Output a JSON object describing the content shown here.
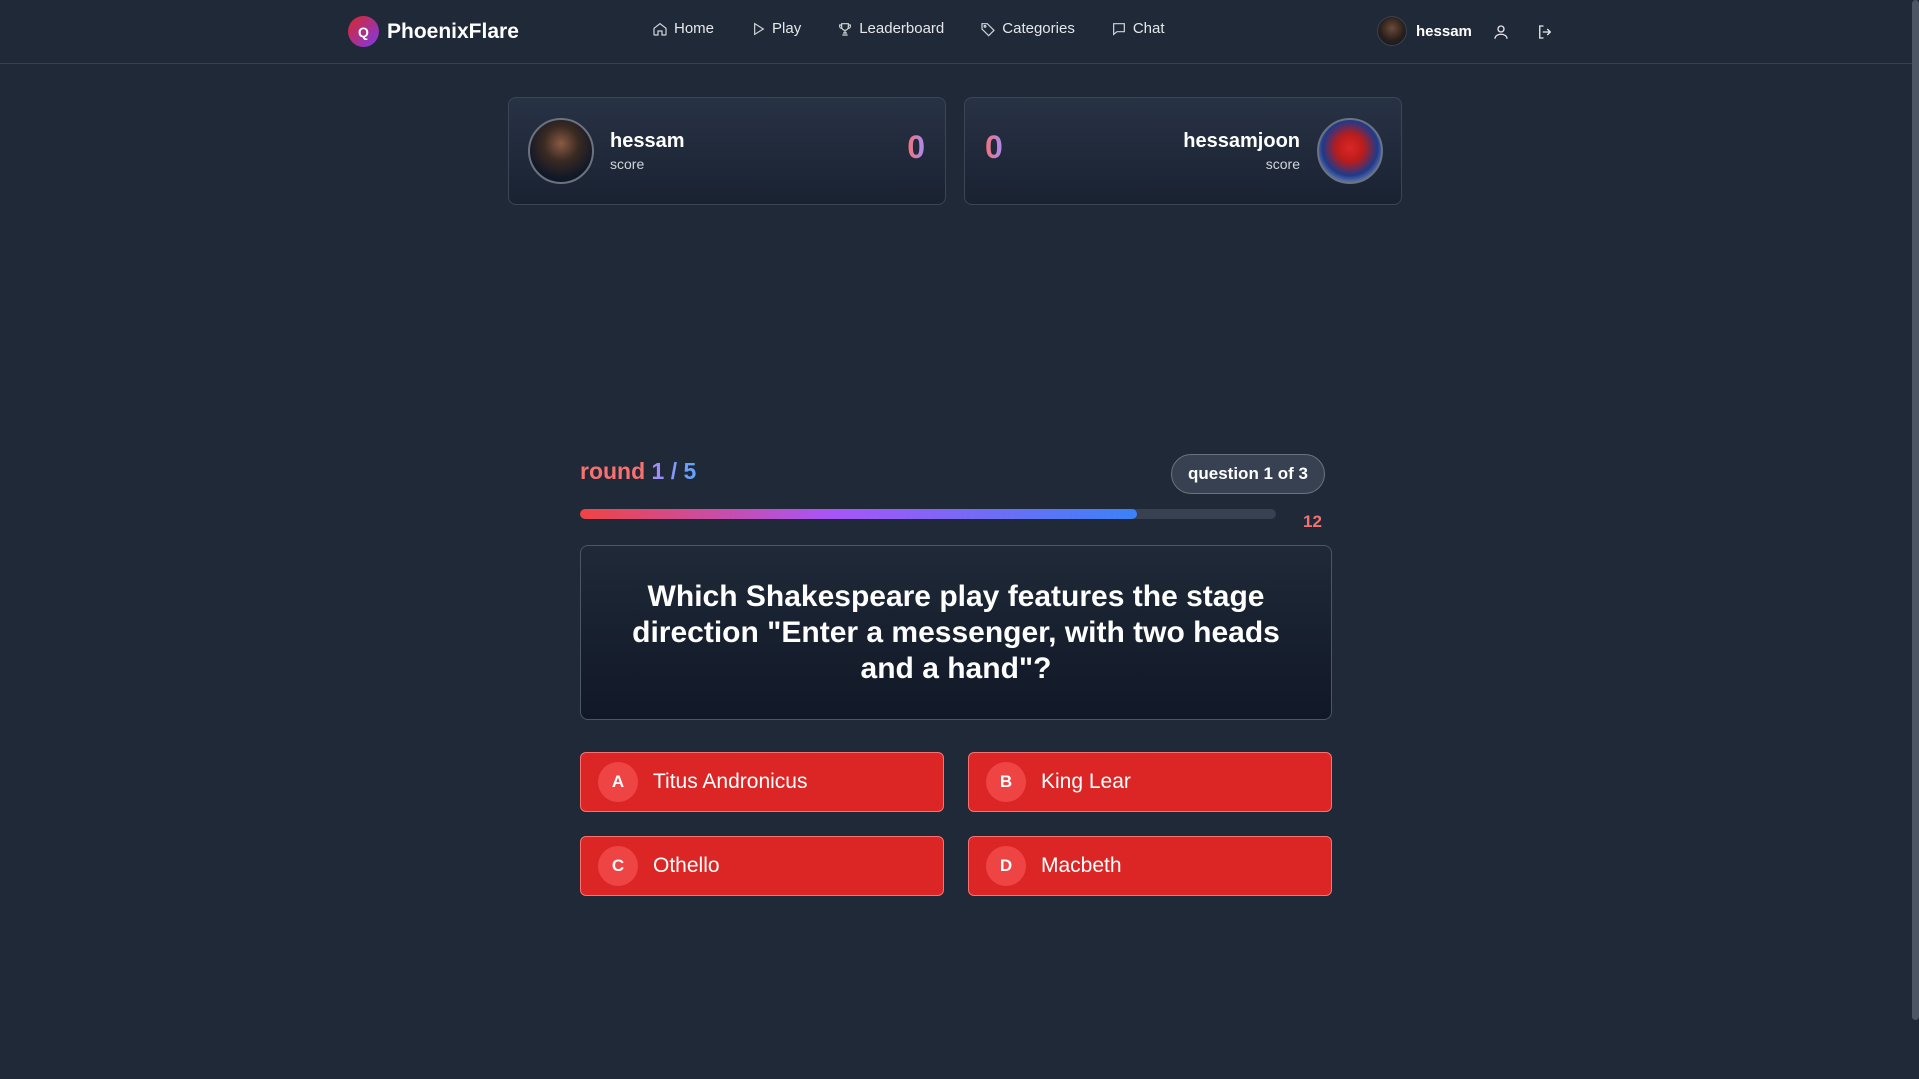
{
  "brand": {
    "logo_letter": "Q",
    "name": "PhoenixFlare"
  },
  "nav": [
    {
      "label": "Home",
      "icon": "home-icon"
    },
    {
      "label": "Play",
      "icon": "play-icon"
    },
    {
      "label": "Leaderboard",
      "icon": "trophy-icon"
    },
    {
      "label": "Categories",
      "icon": "tag-icon"
    },
    {
      "label": "Chat",
      "icon": "chat-icon"
    }
  ],
  "user": {
    "name": "hessam"
  },
  "players": {
    "left": {
      "name": "hessam",
      "sub": "score",
      "score": "0"
    },
    "right": {
      "name": "hessamjoon",
      "sub": "score",
      "score": "0"
    }
  },
  "game": {
    "round_word": "round",
    "round_value": "1 / 5",
    "question_counter": "question 1 of 3",
    "timer": "12",
    "timer_progress": 0.8,
    "question": "Which Shakespeare play features the stage direction \"Enter a messenger, with two heads and a hand\"?",
    "answers": [
      {
        "letter": "A",
        "text": "Titus Andronicus"
      },
      {
        "letter": "B",
        "text": "King Lear"
      },
      {
        "letter": "C",
        "text": "Othello"
      },
      {
        "letter": "D",
        "text": "Macbeth"
      }
    ]
  },
  "colors": {
    "background": "#1f2937",
    "answer_red": "#dc2626",
    "accent_red": "#f87171",
    "accent_blue": "#60a5fa"
  }
}
